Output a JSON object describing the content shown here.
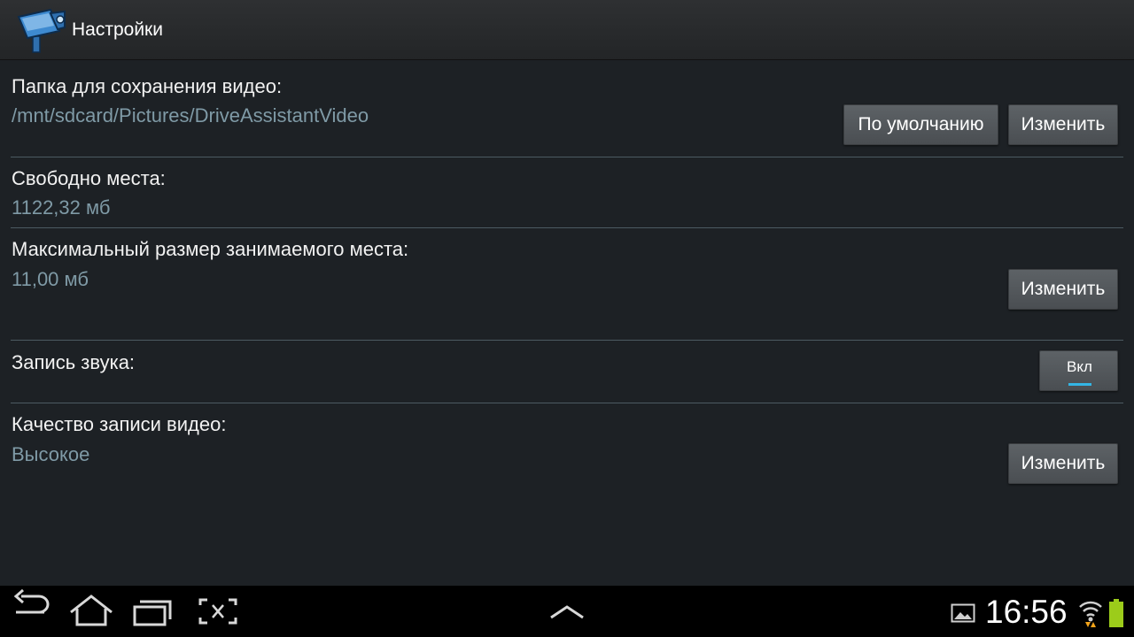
{
  "header": {
    "title": "Настройки",
    "icon": "camera-icon"
  },
  "settings": {
    "folder": {
      "label": "Папка для сохранения видео:",
      "value": "/mnt/sdcard/Pictures/DriveAssistantVideo",
      "default_button": "По умолчанию",
      "change_button": "Изменить"
    },
    "free_space": {
      "label": "Свободно места:",
      "value": "1122,32 мб"
    },
    "max_size": {
      "label": "Максимальный размер занимаемого места:",
      "value": "11,00 мб",
      "change_button": "Изменить"
    },
    "sound": {
      "label": "Запись звука:",
      "toggle_label": "Вкл",
      "enabled": true
    },
    "quality": {
      "label": "Качество записи видео:",
      "value": "Высокое",
      "change_button": "Изменить"
    }
  },
  "navbar": {
    "buttons": [
      "back-icon",
      "home-icon",
      "recent-apps-icon",
      "screenshot-icon",
      "menu-up-icon"
    ],
    "status": {
      "time": "16:56",
      "icons": [
        "gallery-notification-icon",
        "wifi-icon",
        "battery-icon"
      ]
    }
  },
  "colors": {
    "accent": "#33b5e5",
    "value_text": "#7f9aa6",
    "background": "#1d2125",
    "battery": "#9ccc1a"
  }
}
